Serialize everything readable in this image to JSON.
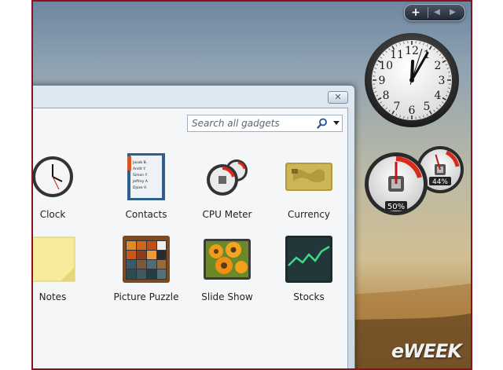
{
  "sidebar": {
    "add": "+",
    "prev": "◀",
    "next": "▶"
  },
  "desktop_clock": {
    "numerals": [
      "12",
      "1",
      "2",
      "3",
      "4",
      "5",
      "6",
      "7",
      "8",
      "9",
      "10",
      "11"
    ],
    "time": {
      "hour": 12,
      "minute": 5,
      "second": 3
    }
  },
  "cpu_meter": {
    "cpu_percent": 50,
    "memory_percent": 44,
    "cpu_label": "50%",
    "memory_label": "44%"
  },
  "watermark": "eWEEK",
  "gallery": {
    "close_label": "✕",
    "search": {
      "placeholder": "Search all gadgets"
    },
    "gadgets": [
      {
        "label": "Clock",
        "icon": "clock-icon"
      },
      {
        "label": "Contacts",
        "icon": "contacts-icon",
        "names": [
          "Jacob B.",
          "Andit Y.",
          "Simon Y.",
          "Jeffrey A.",
          "Djoze V."
        ]
      },
      {
        "label": "CPU Meter",
        "icon": "cpu-meter-icon"
      },
      {
        "label": "Currency",
        "icon": "currency-icon"
      },
      {
        "label": "Notes",
        "icon": "notes-icon"
      },
      {
        "label": "Picture Puzzle",
        "icon": "picture-puzzle-icon"
      },
      {
        "label": "Slide Show",
        "icon": "slide-show-icon"
      },
      {
        "label": "Stocks",
        "icon": "stocks-icon"
      }
    ]
  },
  "colors": {
    "frame_border": "#8b1020",
    "meter_red": "#d92a1c",
    "stocks_line": "#3fd98a"
  }
}
